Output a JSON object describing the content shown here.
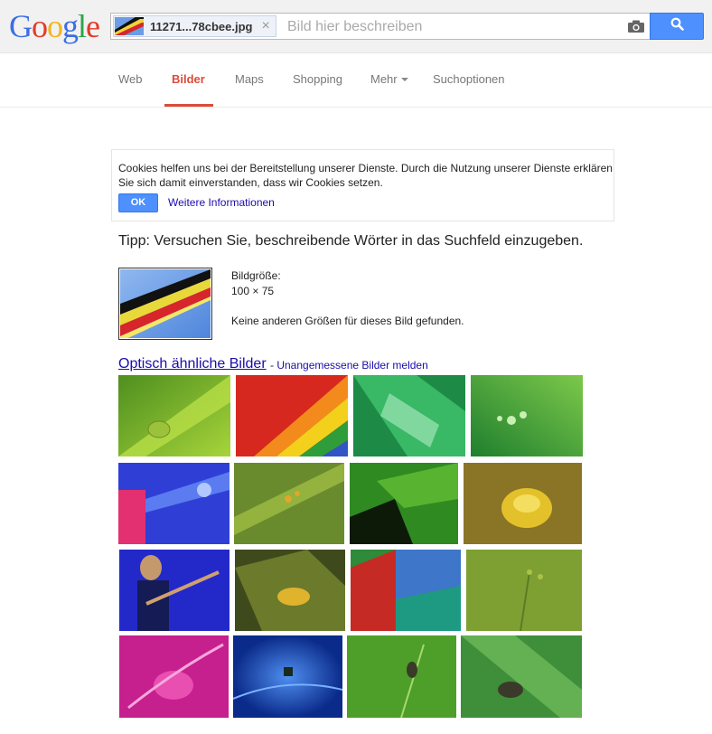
{
  "logo": {
    "letters": [
      "G",
      "o",
      "o",
      "g",
      "l",
      "e"
    ],
    "colors": [
      "#3b6ee5",
      "#e23b2b",
      "#f3b51b",
      "#3b6ee5",
      "#2ea34a",
      "#e23b2b"
    ]
  },
  "search": {
    "chip_filename": "11271...78cbee.jpg",
    "chip_close": "×",
    "placeholder": "Bild hier beschreiben",
    "camera_icon": "camera-icon",
    "search_icon": "search-icon"
  },
  "nav": {
    "items": [
      "Web",
      "Bilder",
      "Maps",
      "Shopping",
      "Mehr",
      "Suchoptionen"
    ],
    "active": "Bilder",
    "accent": "#dd4b39"
  },
  "cookie": {
    "text": "Cookies helfen uns bei der Bereitstellung unserer Dienste. Durch die Nutzung unserer Dienste erklären Sie sich damit einverstanden, dass wir Cookies setzen.",
    "ok_label": "OK",
    "more_label": "Weitere Informationen"
  },
  "tip": "Tipp: Versuchen Sie, beschreibende Wörter in das Suchfeld einzugeben.",
  "query_image": {
    "size_label": "Bildgröße:",
    "size_value": "100 × 75",
    "no_sizes": "Keine anderen Größen für dieses Bild gefunden."
  },
  "similar": {
    "title": "Optisch ähnliche Bilder",
    "dash": "-",
    "report": "Unangemessene Bilder melden"
  },
  "colors": {
    "link": "#1a0dab",
    "button_blue": "#4d90fe"
  }
}
